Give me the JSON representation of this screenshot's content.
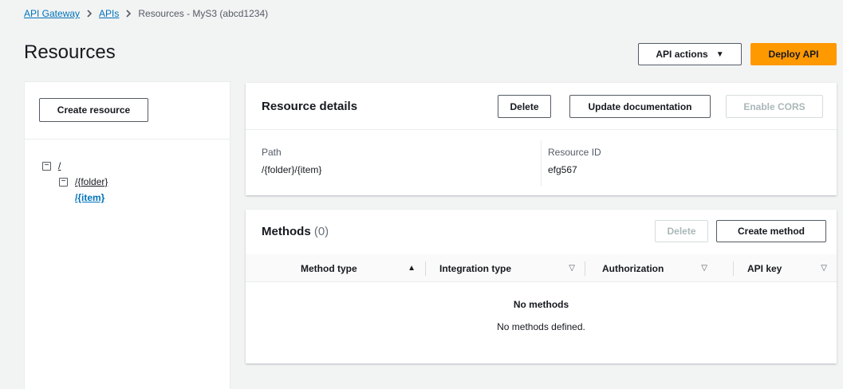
{
  "breadcrumb": {
    "items": [
      {
        "label": "API Gateway"
      },
      {
        "label": "APIs"
      },
      {
        "label": "Resources - MyS3 (abcd1234)"
      }
    ]
  },
  "page": {
    "title": "Resources"
  },
  "header_actions": {
    "api_actions_label": "API actions",
    "deploy_label": "Deploy API"
  },
  "left_panel": {
    "create_resource_label": "Create resource",
    "tree": [
      {
        "label": "/"
      },
      {
        "label": "/{folder}"
      },
      {
        "label": "/{item}",
        "selected": true
      }
    ]
  },
  "resource_details": {
    "title": "Resource details",
    "delete_label": "Delete",
    "update_doc_label": "Update documentation",
    "enable_cors_label": "Enable CORS",
    "path_label": "Path",
    "path_value": "/{folder}/{item}",
    "resource_id_label": "Resource ID",
    "resource_id_value": "efg567"
  },
  "methods": {
    "title": "Methods",
    "count": "(0)",
    "delete_label": "Delete",
    "create_label": "Create method",
    "columns": [
      "Method type",
      "Integration type",
      "Authorization",
      "API key"
    ],
    "empty_title": "No methods",
    "empty_description": "No methods defined."
  },
  "colors": {
    "accent": "#ff9900",
    "link": "#0073bb",
    "background": "#f2f3f3"
  }
}
